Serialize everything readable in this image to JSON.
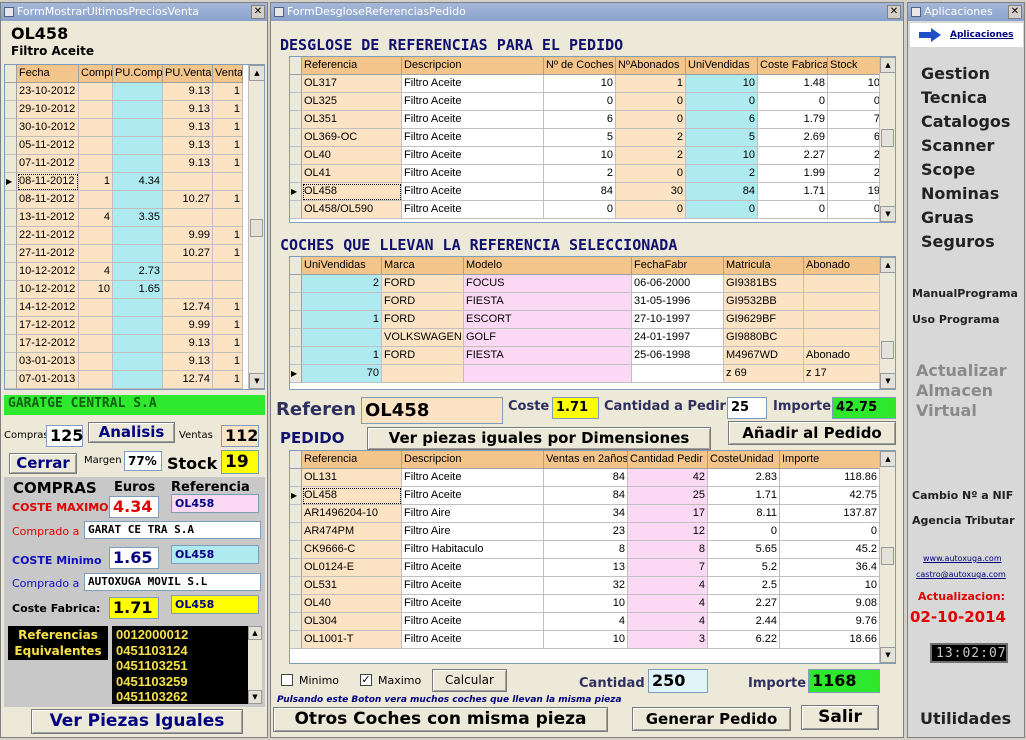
{
  "left_window": {
    "title": "FormMostrarUltimosPreciosVenta",
    "ref_code": "OL458",
    "ref_desc": "Filtro Aceite",
    "grid_columns": [
      "Fecha",
      "Compr",
      "PU.Compr",
      "PU.Venta",
      "Venta"
    ],
    "grid_rows": [
      {
        "fecha": "23-10-2012",
        "compra": "",
        "pucompra": "",
        "puventa": "9.13",
        "venta": "1"
      },
      {
        "fecha": "29-10-2012",
        "compra": "",
        "pucompra": "",
        "puventa": "9.13",
        "venta": "1"
      },
      {
        "fecha": "30-10-2012",
        "compra": "",
        "pucompra": "",
        "puventa": "9.13",
        "venta": "1"
      },
      {
        "fecha": "05-11-2012",
        "compra": "",
        "pucompra": "",
        "puventa": "9.13",
        "venta": "1"
      },
      {
        "fecha": "07-11-2012",
        "compra": "",
        "pucompra": "",
        "puventa": "9.13",
        "venta": "1"
      },
      {
        "fecha": "08-11-2012",
        "compra": "1",
        "pucompra": "4.34",
        "puventa": "",
        "venta": "",
        "current": true
      },
      {
        "fecha": "08-11-2012",
        "compra": "",
        "pucompra": "",
        "puventa": "10.27",
        "venta": "1"
      },
      {
        "fecha": "13-11-2012",
        "compra": "4",
        "pucompra": "3.35",
        "puventa": "",
        "venta": ""
      },
      {
        "fecha": "22-11-2012",
        "compra": "",
        "pucompra": "",
        "puventa": "9.99",
        "venta": "1"
      },
      {
        "fecha": "27-11-2012",
        "compra": "",
        "pucompra": "",
        "puventa": "10.27",
        "venta": "1"
      },
      {
        "fecha": "10-12-2012",
        "compra": "4",
        "pucompra": "2.73",
        "puventa": "",
        "venta": ""
      },
      {
        "fecha": "10-12-2012",
        "compra": "10",
        "pucompra": "1.65",
        "puventa": "",
        "venta": ""
      },
      {
        "fecha": "14-12-2012",
        "compra": "",
        "pucompra": "",
        "puventa": "12.74",
        "venta": "1"
      },
      {
        "fecha": "17-12-2012",
        "compra": "",
        "pucompra": "",
        "puventa": "9.99",
        "venta": "1"
      },
      {
        "fecha": "17-12-2012",
        "compra": "",
        "pucompra": "",
        "puventa": "9.13",
        "venta": "1"
      },
      {
        "fecha": "03-01-2013",
        "compra": "",
        "pucompra": "",
        "puventa": "9.13",
        "venta": "1"
      },
      {
        "fecha": "07-01-2013",
        "compra": "",
        "pucompra": "",
        "puventa": "12.74",
        "venta": "1"
      }
    ],
    "customer_name": "GARATGE CENTRAL S.A",
    "compras_label": "Compras",
    "compras_value": "125",
    "analisis_button": "Analisis",
    "ventas_label": "Ventas",
    "ventas_value": "112",
    "cerrar_button": "Cerrar",
    "margen_label": "Margen",
    "margen_value": "77%",
    "stock_label": "Stock",
    "stock_value": "19",
    "compras_heading": "COMPRAS",
    "euros_label": "Euros",
    "referencia_label": "Referencia",
    "coste_maximo_label": "COSTE MAXIMO",
    "coste_maximo_value": "4.34",
    "coste_maximo_ref": "OL458",
    "comprado_a_label": "Comprado a",
    "comprado_a_max": "GARAT     CE     TRA     S.A",
    "coste_minimo_label": "COSTE Minimo",
    "coste_minimo_value": "1.65",
    "coste_minimo_ref": "OL458",
    "comprado_a_min": "AUTOXUGA MOVIL S.L",
    "coste_fabrica_label": "Coste Fabrica:",
    "coste_fabrica_value": "1.71",
    "coste_fabrica_ref": "OL458",
    "ref_equiv_label_1": "Referencias",
    "ref_equiv_label_2": "Equivalentes",
    "ref_equivalentes": [
      "0012000012",
      "0451103124",
      "0451103251",
      "0451103259",
      "0451103262"
    ],
    "ver_piezas_button": "Ver Piezas Iguales"
  },
  "center_window": {
    "title": "FormDesgloseReferenciasPedido",
    "desglose_heading": "DESGLOSE DE REFERENCIAS PARA EL PEDIDO",
    "desglose_columns": [
      "Referencia",
      "Descripcion",
      "Nº de Coches",
      "NºAbonados",
      "UniVendidas",
      "Coste Fabrica",
      "Stock"
    ],
    "desglose_rows": [
      {
        "ref": "OL317",
        "desc": "Filtro Aceite",
        "coches": "10",
        "abonados": "1",
        "vendidas": "10",
        "coste": "1.48",
        "stock": "10"
      },
      {
        "ref": "OL325",
        "desc": "Filtro Aceite",
        "coches": "0",
        "abonados": "0",
        "vendidas": "0",
        "coste": "0",
        "stock": "0"
      },
      {
        "ref": "OL351",
        "desc": "Filtro Aceite",
        "coches": "6",
        "abonados": "0",
        "vendidas": "6",
        "coste": "1.79",
        "stock": "7"
      },
      {
        "ref": "OL369-OC",
        "desc": "Filtro Aceite",
        "coches": "5",
        "abonados": "2",
        "vendidas": "5",
        "coste": "2.69",
        "stock": "6"
      },
      {
        "ref": "OL40",
        "desc": "Filtro Aceite",
        "coches": "10",
        "abonados": "2",
        "vendidas": "10",
        "coste": "2.27",
        "stock": "2"
      },
      {
        "ref": "OL41",
        "desc": "Filtro Aceite",
        "coches": "2",
        "abonados": "0",
        "vendidas": "2",
        "coste": "1.99",
        "stock": "2"
      },
      {
        "ref": "OL458",
        "desc": "Filtro Aceite",
        "coches": "84",
        "abonados": "30",
        "vendidas": "84",
        "coste": "1.71",
        "stock": "19",
        "current": true
      },
      {
        "ref": "OL458/OL590",
        "desc": "Filtro Aceite",
        "coches": "0",
        "abonados": "0",
        "vendidas": "0",
        "coste": "0",
        "stock": "0"
      }
    ],
    "coches_heading": "COCHES QUE LLEVAN LA REFERENCIA SELECCIONADA",
    "coches_columns": [
      "UniVendidas",
      "Marca",
      "Modelo",
      "FechaFabr",
      "Matricula",
      "Abonado"
    ],
    "coches_rows": [
      {
        "uni": "2",
        "marca": "FORD",
        "modelo": "FOCUS",
        "fecha": "06-06-2000",
        "matricula": "GI9381BS",
        "abonado": ""
      },
      {
        "uni": "",
        "marca": "FORD",
        "modelo": "FIESTA",
        "fecha": "31-05-1996",
        "matricula": "GI9532BB",
        "abonado": ""
      },
      {
        "uni": "1",
        "marca": "FORD",
        "modelo": "ESCORT",
        "fecha": "27-10-1997",
        "matricula": "GI9629BF",
        "abonado": ""
      },
      {
        "uni": "",
        "marca": "VOLKSWAGEN",
        "modelo": "GOLF",
        "fecha": "24-01-1997",
        "matricula": "GI9880BC",
        "abonado": ""
      },
      {
        "uni": "1",
        "marca": "FORD",
        "modelo": "FIESTA",
        "fecha": "25-06-1998",
        "matricula": "M4967WD",
        "abonado": "Abonado"
      }
    ],
    "coches_totals": {
      "uni": "70",
      "matricula": "z  69",
      "abonado": "z  17"
    },
    "referen_label": "Referen",
    "referen_value": "OL458",
    "coste_label": "Coste",
    "coste_value": "1.71",
    "cantidad_pedir_label": "Cantidad a Pedir",
    "cantidad_pedir_value": "25",
    "importe_label": "Importe",
    "importe_value": "42.75",
    "pedido_heading": "PEDIDO",
    "ver_dimensiones_button": "Ver piezas iguales por Dimensiones",
    "anadir_button": "Añadir al Pedido",
    "pedido_columns": [
      "Referencia",
      "Descripcion",
      "Ventas en 2años",
      "Cantidad Pedir",
      "CosteUnidad",
      "Importe"
    ],
    "pedido_rows": [
      {
        "ref": "OL131",
        "desc": "Filtro Aceite",
        "ventas": "84",
        "cantidad": "42",
        "coste": "2.83",
        "importe": "118.86"
      },
      {
        "ref": "OL458",
        "desc": "Filtro Aceite",
        "ventas": "84",
        "cantidad": "25",
        "coste": "1.71",
        "importe": "42.75",
        "current": true
      },
      {
        "ref": "AR1496204-10",
        "desc": "Filtro Aire",
        "ventas": "34",
        "cantidad": "17",
        "coste": "8.11",
        "importe": "137.87"
      },
      {
        "ref": "AR474PM",
        "desc": "Filtro Aire",
        "ventas": "23",
        "cantidad": "12",
        "coste": "0",
        "importe": "0"
      },
      {
        "ref": "CK9666-C",
        "desc": "Filtro Habitaculo",
        "ventas": "8",
        "cantidad": "8",
        "coste": "5.65",
        "importe": "45.2"
      },
      {
        "ref": "OL0124-E",
        "desc": "Filtro Aceite",
        "ventas": "13",
        "cantidad": "7",
        "coste": "5.2",
        "importe": "36.4"
      },
      {
        "ref": "OL531",
        "desc": "Filtro Aceite",
        "ventas": "32",
        "cantidad": "4",
        "coste": "2.5",
        "importe": "10"
      },
      {
        "ref": "OL40",
        "desc": "Filtro Aceite",
        "ventas": "10",
        "cantidad": "4",
        "coste": "2.27",
        "importe": "9.08"
      },
      {
        "ref": "OL304",
        "desc": "Filtro Aceite",
        "ventas": "4",
        "cantidad": "4",
        "coste": "2.44",
        "importe": "9.76"
      },
      {
        "ref": "OL1001-T",
        "desc": "Filtro Aceite",
        "ventas": "10",
        "cantidad": "3",
        "coste": "6.22",
        "importe": "18.66"
      }
    ],
    "minimo_label": "Minimo",
    "maximo_label": "Maximo",
    "calcular_button": "Calcular",
    "cantidad_label": "Cantidad",
    "cantidad_value": "250",
    "importe_total_label": "Importe",
    "importe_total_value": "1168",
    "hint_text": "Pulsando este Boton vera muchos coches que llevan la misma pieza",
    "otros_coches_button": "Otros Coches con misma pieza",
    "generar_button": "Generar Pedido",
    "salir_button": "Salir"
  },
  "right_window": {
    "title": "Aplicaciones",
    "aplicaciones_link": "Aplicaciones",
    "menu_items": [
      "Gestion",
      "Tecnica",
      "Catalogos",
      "Scanner",
      "Scope",
      "Nominas",
      "Gruas",
      "Seguros"
    ],
    "manual_link": "ManualPrograma",
    "uso_link": "Uso Programa",
    "actualizar_1": "Actualizar",
    "actualizar_2": "Almacen",
    "actualizar_3": "Virtual",
    "cambio_nif": "Cambio Nº a NIF",
    "agencia": "Agencia Tributar",
    "web_link": "www.autoxuga.com",
    "email_link": "castro@autoxuga.com",
    "actualizacion_label": "Actualizacion:",
    "actualizacion_date": "02-10-2014",
    "clock": "13:02:07",
    "utilidades": "Utilidades"
  },
  "colors": {
    "header_orange": "#f4c58a",
    "col_cyan": "#aeeaf0",
    "col_pink": "#fbd9f4",
    "col_peach": "#fbe3c4",
    "green": "#2ee82e",
    "yellow": "#ffff00",
    "red_value": "#e00000",
    "navy": "#000080"
  }
}
